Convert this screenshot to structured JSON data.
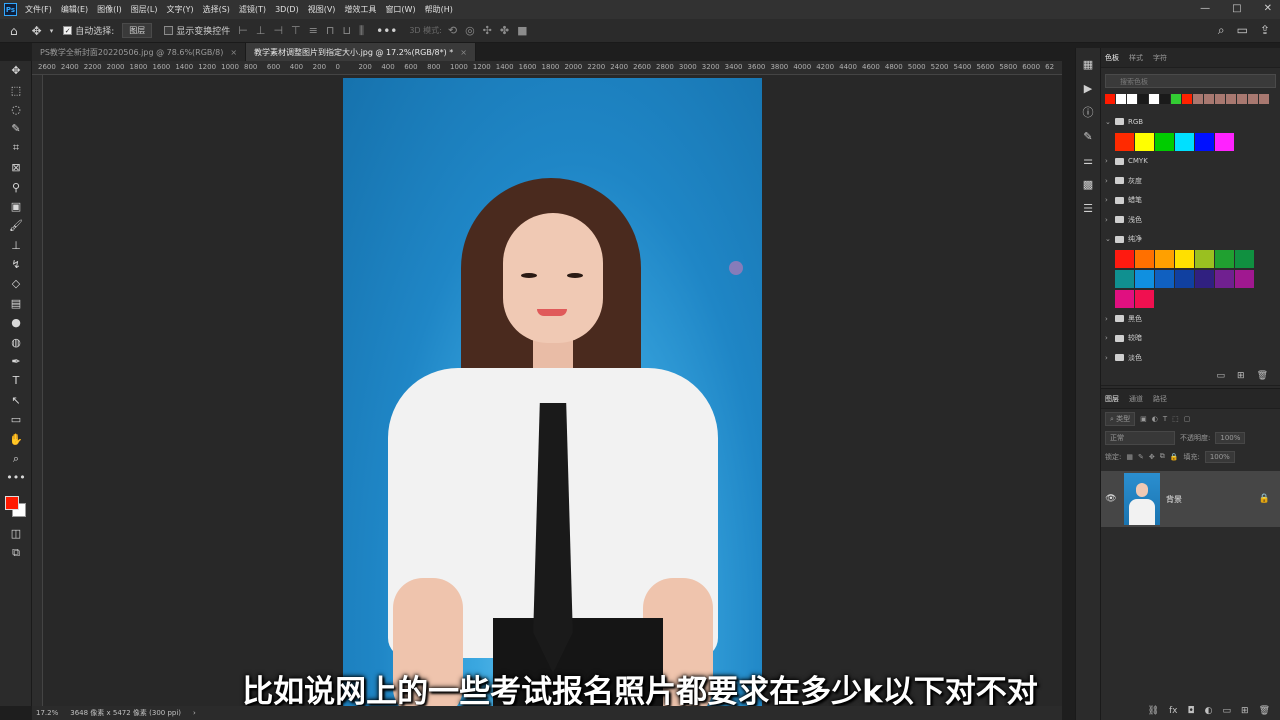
{
  "menubar": {
    "logo": "Ps",
    "items": [
      "文件(F)",
      "编辑(E)",
      "图像(I)",
      "图层(L)",
      "文字(Y)",
      "选择(S)",
      "滤镜(T)",
      "3D(D)",
      "视图(V)",
      "增效工具",
      "窗口(W)",
      "帮助(H)"
    ],
    "window_buttons": [
      "—",
      "□",
      "✕"
    ]
  },
  "options": {
    "auto_select_label": "自动选择:",
    "auto_select_value": "图层",
    "show_transform_label": "显示变换控件",
    "mode_3d_label": "3D 模式:"
  },
  "tabs": [
    {
      "title": "PS教学全新封面20220506.jpg @ 78.6%(RGB/8)",
      "close": "×"
    },
    {
      "title": "教学素材调整图片到指定大小.jpg @ 17.2%(RGB/8*) *",
      "close": "×"
    }
  ],
  "ruler": {
    "top_ticks": [
      "2600",
      "2400",
      "2200",
      "2000",
      "1800",
      "1600",
      "1400",
      "1200",
      "1000",
      "800",
      "600",
      "400",
      "200",
      "0",
      "200",
      "400",
      "600",
      "800",
      "1000",
      "1200",
      "1400",
      "1600",
      "1800",
      "2000",
      "2200",
      "2400",
      "2600",
      "2800",
      "3000",
      "3200",
      "3400",
      "3600",
      "3800",
      "4000",
      "4200",
      "4400",
      "4600",
      "4800",
      "5000",
      "5200",
      "5400",
      "5600",
      "5800",
      "6000",
      "62"
    ]
  },
  "subtitle": "比如说网上的一些考试报名照片都要求在多少k以下对不对",
  "status": {
    "zoom": "17.2%",
    "doc_info": "3648 像素 x 5472 像素 (300 ppi)",
    "arrow": "›"
  },
  "swatches_panel": {
    "tabs": [
      "色板",
      "样式",
      "字符"
    ],
    "search_placeholder": "搜索色板",
    "recent": [
      "#ff1a00",
      "#ffffff",
      "#ffffff",
      "#1a1a1a",
      "#ffffff",
      "#1a1a1a",
      "#33cc33",
      "#ff2200",
      "#a87870",
      "#a87870",
      "#a87870",
      "#a87870",
      "#a87870",
      "#a87870",
      "#a87870"
    ],
    "groups": [
      {
        "name": "RGB",
        "open": true,
        "colors": [
          "#ff2a00",
          "#ffff00",
          "#00cc00",
          "#00e0ff",
          "#0010ff",
          "#ff22ff"
        ]
      },
      {
        "name": "CMYK",
        "open": false
      },
      {
        "name": "灰度",
        "open": false
      },
      {
        "name": "蜡笔",
        "open": false
      },
      {
        "name": "浅色",
        "open": false
      },
      {
        "name": "纯净",
        "open": true,
        "colors": [
          "#ff1a10",
          "#ff7000",
          "#ffa000",
          "#ffe000",
          "#9ac020",
          "#20a030",
          "#109040",
          "#109090",
          "#1090e0",
          "#1060c0",
          "#1040a0",
          "#302080",
          "#702090",
          "#a01890",
          "#e01080",
          "#f01050"
        ]
      },
      {
        "name": "黑色",
        "open": false
      },
      {
        "name": "较暗",
        "open": false
      },
      {
        "name": "淡色",
        "open": false
      }
    ]
  },
  "layers_panel": {
    "tabs": [
      "图层",
      "通道",
      "路径"
    ],
    "filter_label": "类型",
    "blend_mode": "正常",
    "opacity_label": "不透明度:",
    "opacity_value": "100%",
    "lock_label": "锁定:",
    "fill_label": "填充:",
    "fill_value": "100%",
    "layer_name": "背景"
  }
}
